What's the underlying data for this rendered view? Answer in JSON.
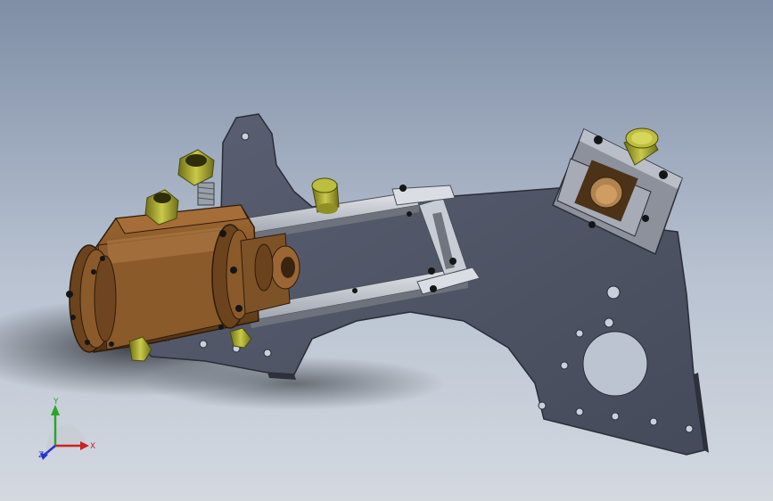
{
  "viewport": {
    "background_top": "#7f8ea6",
    "background_bottom": "#d4d9e0",
    "colors": {
      "plate": "#4f5466",
      "plate_dark": "#3a3e4c",
      "bronze": "#8a5a2a",
      "bronze_dark": "#5a3818",
      "brass": "#a8a92e",
      "steel": "#c4c8d0",
      "bolt": "#151515"
    }
  },
  "triad": {
    "y_label": "Y",
    "x_label": "X",
    "z_label": "Z",
    "y_color": "#2aa52a",
    "x_color": "#cc2222",
    "z_color": "#2233cc"
  }
}
